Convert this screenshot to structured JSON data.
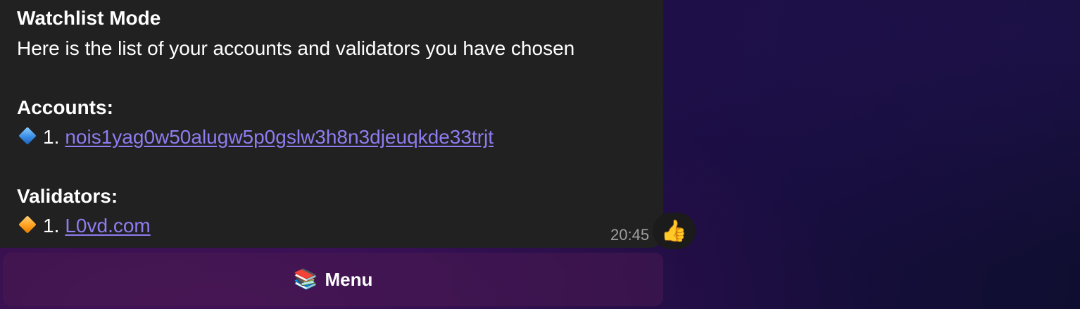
{
  "message": {
    "title": "Watchlist Mode",
    "intro": "Here is the list of your accounts and validators you have chosen",
    "accounts_heading": "Accounts:",
    "accounts": [
      {
        "index": "1.",
        "address": "nois1yag0w50alugw5p0gslw3h8n3djeuqkde33trjt",
        "icon": "small-blue-diamond-icon"
      }
    ],
    "validators_heading": "Validators:",
    "validators": [
      {
        "index": "1.",
        "name": "L0vd.com",
        "icon": "small-orange-diamond-icon"
      }
    ],
    "time": "20:45"
  },
  "reaction": {
    "emoji": "👍",
    "icon": "thumbs-up-icon"
  },
  "keyboard": {
    "menu_icon": "📚",
    "menu_label": "Menu"
  },
  "colors": {
    "bubble_bg": "#212121",
    "link": "#8f7cf0",
    "timestamp": "#9e9e9e"
  }
}
